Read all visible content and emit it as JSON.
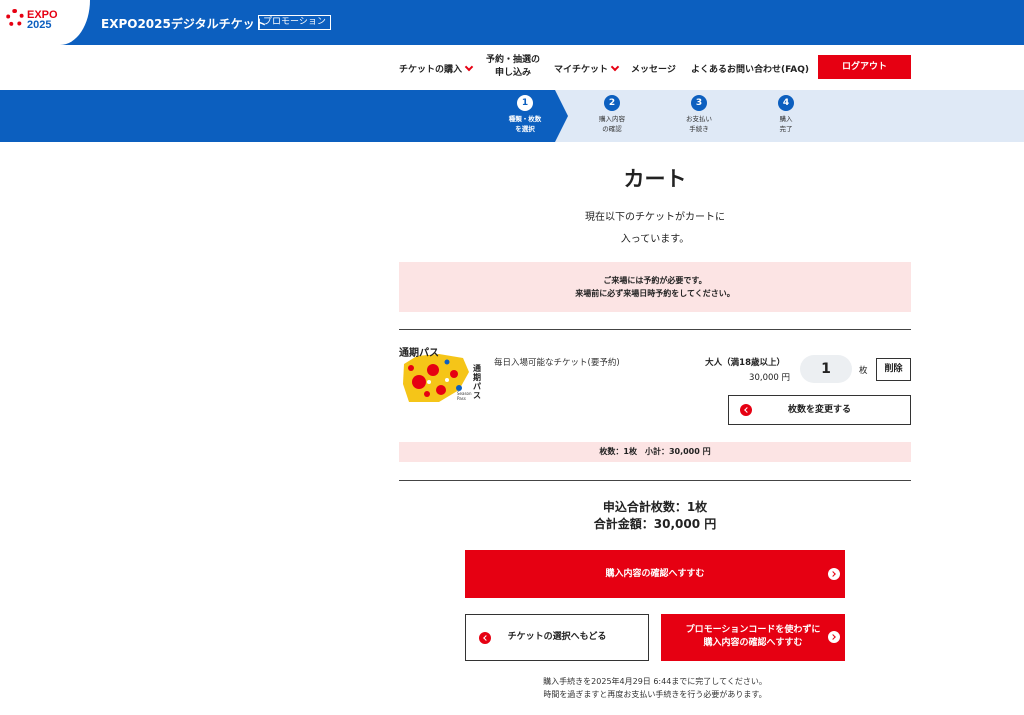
{
  "header": {
    "logo_text_top": "EXPO",
    "logo_text_bottom": "2025",
    "site_title": "EXPO2025デジタルチケット",
    "badge": "プロモーション"
  },
  "nav": {
    "buy_ticket": "チケットの購入",
    "reserve_line1": "予約・抽選の",
    "reserve_line2": "申し込み",
    "my_ticket": "マイチケット",
    "messages": "メッセージ",
    "faq": "よくあるお問い合わせ(FAQ)",
    "logout": "ログアウト"
  },
  "steps": [
    {
      "num": "1",
      "line1": "種類・枚数",
      "line2": "を選択",
      "active": true
    },
    {
      "num": "2",
      "line1": "購入内容",
      "line2": "の確認",
      "active": false
    },
    {
      "num": "3",
      "line1": "お支払い",
      "line2": "手続き",
      "active": false
    },
    {
      "num": "4",
      "line1": "購入",
      "line2": "完了",
      "active": false
    }
  ],
  "main": {
    "title": "カート",
    "message_line1": "現在以下のチケットがカートに",
    "message_line2": "入っています。",
    "notice_line1": "ご来場には予約が必要です。",
    "notice_line2": "来場前に必ず来場日時予約をしてください。"
  },
  "ticket": {
    "image_title": "通期パス",
    "image_vertical": "通期パス",
    "image_caption": "Season Pass",
    "description": "毎日入場可能なチケット(要予約)",
    "type": "大人（満18歳以上）",
    "price": "30,000 円",
    "quantity": "1",
    "unit": "枚",
    "delete": "削除",
    "change_qty": "枚数を変更する",
    "subtotal": "枚数：1枚　小計：30,000 円"
  },
  "totals": {
    "count": "申込合計枚数：1枚",
    "amount": "合計金額：30,000 円"
  },
  "buttons": {
    "confirm": "購入内容の確認へすすむ",
    "back": "チケットの選択へもどる",
    "promo_line1": "プロモーションコードを使わずに",
    "promo_line2": "購入内容の確認へすすむ"
  },
  "footnote": {
    "line1": "購入手続きを2025年4月29日 6:44までに完了してください。",
    "line2": "時間を過ぎますと再度お支払い手続きを行う必要があります。"
  },
  "colors": {
    "brand_blue": "#0c5fbf",
    "accent_red": "#e60012",
    "notice_pink": "#fce4e4"
  }
}
